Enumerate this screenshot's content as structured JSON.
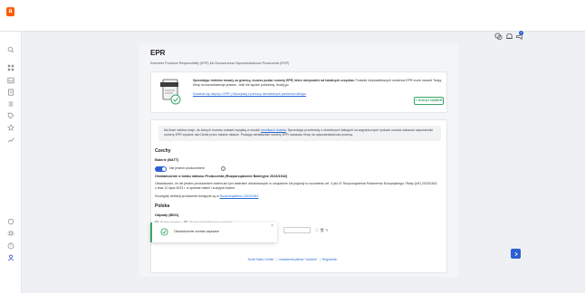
{
  "app": {
    "logo_letter": "a"
  },
  "header": {
    "notification_count": "1",
    "icons": [
      "chat-icon",
      "bell-icon",
      "megaphone-icon"
    ]
  },
  "sidebar": {
    "icons": [
      "search-icon",
      "grid-icon",
      "inbox-icon",
      "orders-icon",
      "list-icon",
      "tag-icon",
      "star-icon",
      "chart-icon",
      "support-icon",
      "settings-icon",
      "help-icon",
      "user-icon"
    ]
  },
  "page": {
    "title": "EPR",
    "subtitle": "Extended Producer Responsibility (EPR) lub Rozszerzona Odpowiedzialność Producenta (ROP)"
  },
  "banner": {
    "bold": "Sprzedając niektóre towary za granicą, musisz podać numery EPR, które otrzymałeś od lokalnych urzędów.",
    "text": " Podanie nieprawidłowych numerów EPR może narazić Twoją firmę na konsekwencje prawne. Jeśli nie będzie potrzebny, dodaj go.",
    "link1": "Dowiedz się więcej o EPR",
    "link_sep": " | ",
    "link2": "Skorzystaj z pomocy niezależnych partnerów Allegro",
    "button": "+ DODAJ NUMER"
  },
  "info": {
    "text_before": "Na liście widzisz kraje, do których możesz ustawić wysyłkę w swoich ",
    "link": "cennikach dostaw",
    "text_after": ". Sprzedając przedmioty z określonych kategorii na zagranicznych rynkach musisz wskazać odpowiednie numery EPR wydane dla Ciebie przez lokalne władze. Podając niewłaściwe numery EPR narażasz firmę na odpowiedzialność prawną."
  },
  "czechy": {
    "heading": "Czechy",
    "battery_label": "Baterie (BATT)",
    "toggle_label": "Nie jestem producentem",
    "statement_title": "Oświadczenie o braku statusu Producenta (Rozporządzenie Bateryjne 2023/1542)",
    "statement_text": "Oświadczam, że nie jestem producentem baterii ani tym bateriami wbudowanych w urządzenie lub pojazdy w rozumieniu art. 3 pkt 47 Rozporządzenia Parlamentu Europejskiego i Rady (UE) 2023/1542 z dnia 12 lipca 2023 r. w sprawie baterii i zużytych baterii.",
    "details_text": "Szczegóły definicji producenta dostępne są w ",
    "details_link": "Rozporządzeniu 2023/1542"
  },
  "polska": {
    "heading": "Polska",
    "waste_label": "Odpady (BDO)",
    "radio1": "Numer rejestru",
    "radio2": "Numer identyfikacyjny podmiotu"
  },
  "toast": {
    "message": "Oświadczenie zostało zapisane"
  },
  "footer": {
    "link1": "Dział Sales Center",
    "link2": "Ustawienia plików \"cookies\"",
    "link3": "Regulamin",
    "sep": "|"
  },
  "colors": {
    "accent": "#2d5fd3",
    "success": "#3aa46a",
    "brand": "#ff5a00"
  }
}
